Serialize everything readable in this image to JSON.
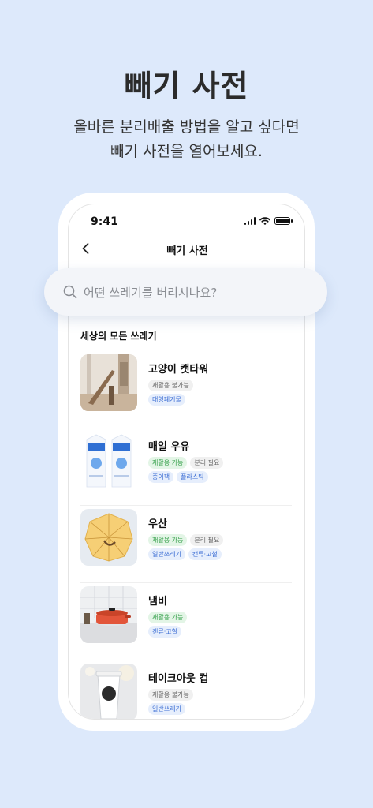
{
  "hero": {
    "title": "빼기 사전",
    "subtitle_line1": "올바른 분리배출 방법을 알고 싶다면",
    "subtitle_line2": "빼기 사전을 열어보세요."
  },
  "status_bar": {
    "time": "9:41",
    "icons": [
      "signal-icon",
      "wifi-icon",
      "battery-icon"
    ]
  },
  "nav": {
    "title": "빼기 사전",
    "back_icon": "chevron-left-icon"
  },
  "search": {
    "placeholder": "어떤 쓰레기를 버리시나요?",
    "icon": "search-icon"
  },
  "section": {
    "title": "세상의 모든 쓰레기"
  },
  "items": [
    {
      "name": "고양이 캣타워",
      "tags": [
        [
          "재활용 불가능"
        ],
        [
          "대형폐기물"
        ]
      ]
    },
    {
      "name": "매일 우유",
      "tags": [
        [
          "재활용 가능",
          "분리 필요"
        ],
        [
          "종이팩",
          "플라스틱"
        ]
      ]
    },
    {
      "name": "우산",
      "tags": [
        [
          "재활용 가능",
          "분리 필요"
        ],
        [
          "일반쓰레기",
          "캔류·고철"
        ]
      ]
    },
    {
      "name": "냄비",
      "tags": [
        [
          "재활용 가능"
        ],
        [
          "캔류·고철"
        ]
      ]
    },
    {
      "name": "테이크아웃 컵",
      "tags": [
        [
          "재활용 불가능"
        ],
        [
          "일반쓰레기"
        ]
      ]
    }
  ],
  "colors": {
    "background": "#dde9fb",
    "tag_gray": "#f0f0f0",
    "tag_green": "#e3f5e6",
    "tag_blue": "#e6eefc"
  }
}
